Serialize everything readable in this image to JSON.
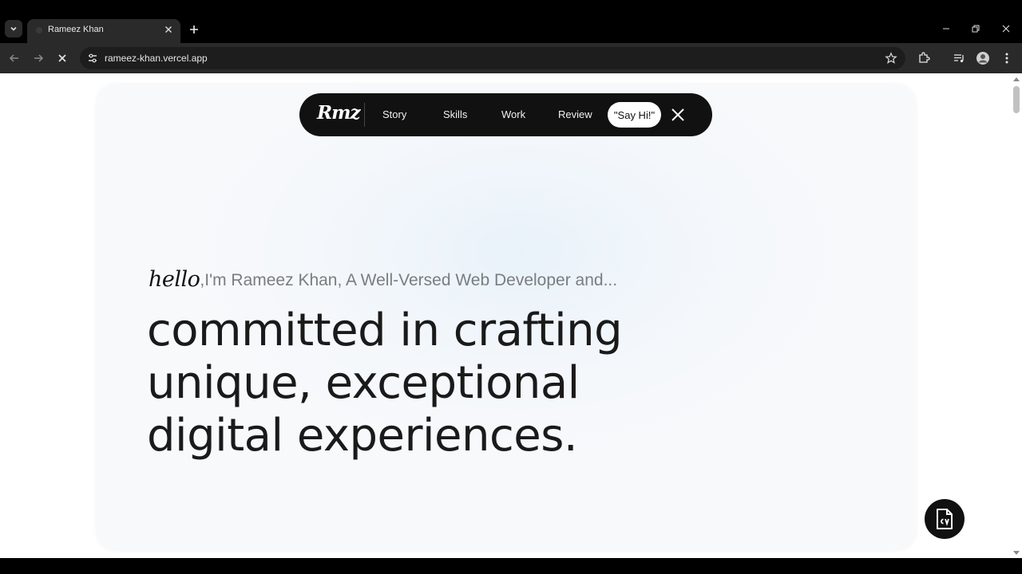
{
  "browser": {
    "tab_title": "Rameez Khan",
    "url": "rameez-khan.vercel.app",
    "icons": {
      "tab_list": "chevron-down-icon",
      "close_tab": "close-icon",
      "new_tab": "plus-icon",
      "minimize": "minimize-icon",
      "restore": "restore-icon",
      "close_window": "close-icon",
      "back": "arrow-left-icon",
      "forward": "arrow-right-icon",
      "stop": "stop-icon",
      "site_info": "tune-icon",
      "bookmark": "star-icon",
      "extensions": "puzzle-icon",
      "media": "media-control-icon",
      "profile": "profile-icon",
      "menu": "kebab-menu-icon"
    }
  },
  "site": {
    "logo": "Rmz",
    "nav": [
      "Story",
      "Skills",
      "Work",
      "Review"
    ],
    "cta": "\"Say Hi!\"",
    "hello": "hello",
    "intro": ",I'm Rameez Khan, A Well-Versed Web Developer and...",
    "headline": [
      "committed in crafting",
      "unique, exceptional",
      "digital experiences."
    ],
    "cv_button_icon": "cv-document-icon",
    "colors": {
      "accent": "#111111",
      "text": "#1a1a1a",
      "muted": "#7a7d80"
    }
  }
}
